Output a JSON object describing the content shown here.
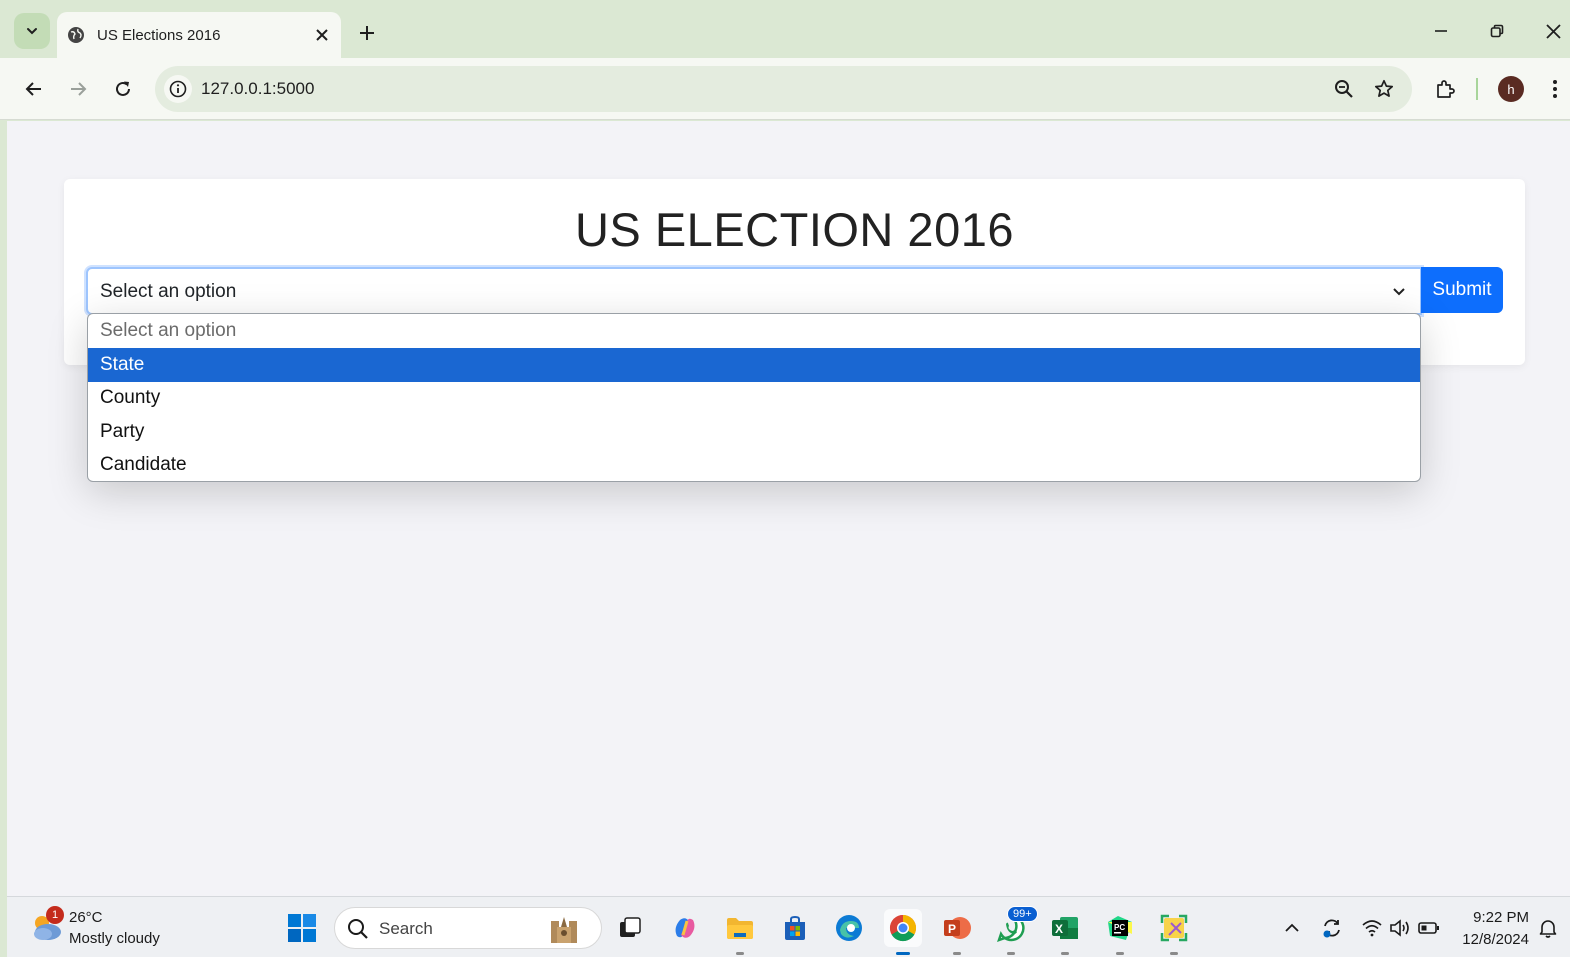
{
  "browser": {
    "tab_title": "US Elections 2016",
    "url": "127.0.0.1:5000",
    "profile_initial": "h"
  },
  "page": {
    "title": "US ELECTION 2016",
    "select_value": "Select an option",
    "submit_label": "Submit",
    "options": [
      {
        "label": "Select an option",
        "placeholder": true
      },
      {
        "label": "State",
        "selected": true
      },
      {
        "label": "County"
      },
      {
        "label": "Party"
      },
      {
        "label": "Candidate"
      }
    ]
  },
  "taskbar": {
    "weather_temp": "26°C",
    "weather_desc": "Mostly cloudy",
    "weather_badge": "1",
    "search_placeholder": "Search",
    "whatsapp_badge": "99+",
    "time": "9:22 PM",
    "date": "12/8/2024"
  },
  "colors": {
    "accent": "#0d6efd",
    "option_highlight": "#1a67d2",
    "chrome_frame": "#dbe8d3"
  }
}
